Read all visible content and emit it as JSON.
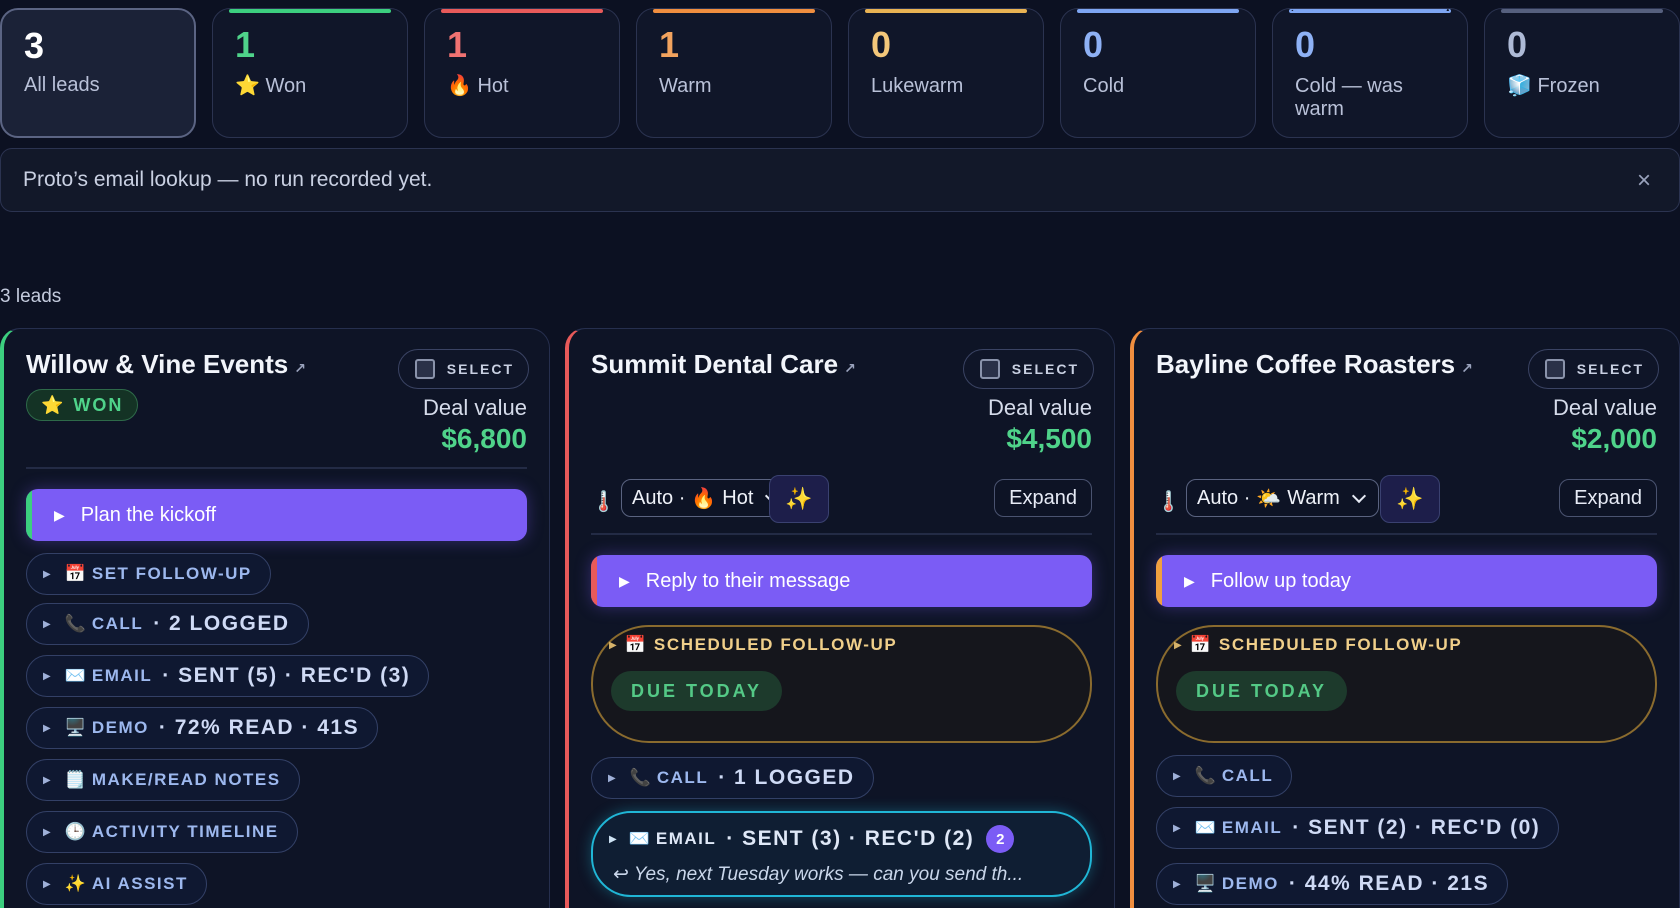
{
  "tiles": [
    {
      "count": "3",
      "icon": "",
      "label": "All leads",
      "color": "#ffffff",
      "accent": "none"
    },
    {
      "count": "1",
      "icon": "⭐",
      "label": "Won",
      "color": "#4fd38a",
      "accent": "#3ccf7f"
    },
    {
      "count": "1",
      "icon": "🔥",
      "label": "Hot",
      "color": "#f07272",
      "accent": "#e85a5a"
    },
    {
      "count": "1",
      "icon": "",
      "label": "Warm",
      "color": "#f2a35e",
      "accent": "#f08e3f"
    },
    {
      "count": "0",
      "icon": "",
      "label": "Lukewarm",
      "color": "#f3c77a",
      "accent": "#e9b353"
    },
    {
      "count": "0",
      "icon": "",
      "label": "Cold",
      "color": "#8eb1f5",
      "accent": "#7ea6f3"
    },
    {
      "count": "0",
      "icon": "",
      "label": "Cold — was warm",
      "color": "#8eb1f5",
      "accent": "#7ea6f3"
    },
    {
      "count": "0",
      "icon": "🧊",
      "label": "Frozen",
      "color": "#aebad6",
      "accent": "#56607e"
    }
  ],
  "banner": {
    "message": "Proto’s email lookup — no run recorded yet.",
    "close": "×"
  },
  "lead_count": "3 leads",
  "select_label": "SELECT",
  "deal_label": "Deal value",
  "expand_label": "Expand",
  "cards": [
    {
      "name": "Willow & Vine Events",
      "ext": "↗",
      "status_badge": "WON",
      "deal_value": "$6,800",
      "accent": "#3ccf7f",
      "action": "Plan the kickoff",
      "pills": [
        {
          "icon": "📅",
          "label": "SET FOLLOW-UP",
          "meta": ""
        },
        {
          "icon": "📞",
          "label": "CALL",
          "meta": "· 2 LOGGED"
        },
        {
          "icon": "✉️",
          "label": "EMAIL",
          "meta": "· SENT (5) · REC'D (3)"
        },
        {
          "icon": "🖥️",
          "label": "DEMO",
          "meta": "· 72% READ · 41S"
        },
        {
          "icon": "🗒️",
          "label": "MAKE/READ NOTES",
          "meta": ""
        },
        {
          "icon": "🕒",
          "label": "ACTIVITY TIMELINE",
          "meta": ""
        },
        {
          "icon": "✨",
          "label": "AI ASSIST",
          "meta": ""
        }
      ]
    },
    {
      "name": "Summit Dental Care",
      "ext": "↗",
      "deal_value": "$4,500",
      "accent": "#e85a5a",
      "temperature": {
        "icon": "🌡️",
        "prefix": "Auto ·",
        "emoji": "🔥",
        "value": "Hot"
      },
      "sparkle": "✨",
      "action": "Reply to their message",
      "scheduled": {
        "icon": "📅",
        "label": "SCHEDULED FOLLOW-UP",
        "due": "DUE TODAY"
      },
      "call": {
        "icon": "📞",
        "label": "CALL",
        "meta": "· 1 LOGGED"
      },
      "email": {
        "icon": "✉️",
        "label": "EMAIL",
        "meta": "· SENT (3) · REC'D (2)",
        "badge": "2",
        "preview": "↩ Yes, next Tuesday works — can you send th..."
      }
    },
    {
      "name": "Bayline Coffee Roasters",
      "ext": "↗",
      "deal_value": "$2,000",
      "accent": "#f08e3f",
      "temperature": {
        "icon": "🌡️",
        "prefix": "Auto ·",
        "emoji": "🌤️",
        "value": "Warm"
      },
      "sparkle": "✨",
      "action": "Follow up today",
      "scheduled": {
        "icon": "📅",
        "label": "SCHEDULED FOLLOW-UP",
        "due": "DUE TODAY"
      },
      "call": {
        "icon": "📞",
        "label": "CALL",
        "meta": ""
      },
      "email": {
        "icon": "✉️",
        "label": "EMAIL",
        "meta": "· SENT (2) · REC'D (0)"
      },
      "demo": {
        "icon": "🖥️",
        "label": "DEMO",
        "meta": "· 44% READ · 21S"
      }
    }
  ]
}
